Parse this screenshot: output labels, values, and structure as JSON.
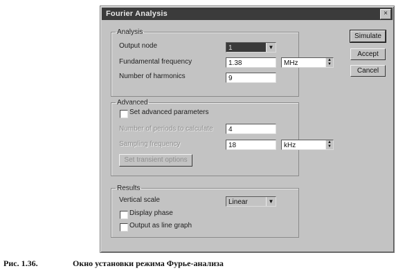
{
  "window": {
    "title": "Fourier Analysis",
    "close_glyph": "×"
  },
  "buttons": {
    "simulate": "Simulate",
    "accept": "Accept",
    "cancel": "Cancel"
  },
  "analysis": {
    "legend": "Analysis",
    "output_node_label": "Output node",
    "output_node_value": "1",
    "fundamental_frequency_label": "Fundamental frequency",
    "fundamental_frequency_value": "1.38",
    "fundamental_frequency_unit": "MHz",
    "harmonics_label": "Number of harmonics",
    "harmonics_value": "9"
  },
  "advanced": {
    "legend": "Advanced",
    "set_advanced_label": "Set advanced parameters",
    "periods_label": "Number of periods to calculate",
    "periods_value": "4",
    "sampling_label": "Sampling frequency",
    "sampling_value": "18",
    "sampling_unit": "kHz",
    "set_transient_label": "Set transient options"
  },
  "results": {
    "legend": "Results",
    "vertical_scale_label": "Vertical scale",
    "vertical_scale_value": "Linear",
    "display_phase_label": "Display phase",
    "line_graph_label": "Output as line graph"
  },
  "caption": {
    "figure": "Рис. 1.36.",
    "text": "Окно установки режима Фурье-анализа"
  }
}
